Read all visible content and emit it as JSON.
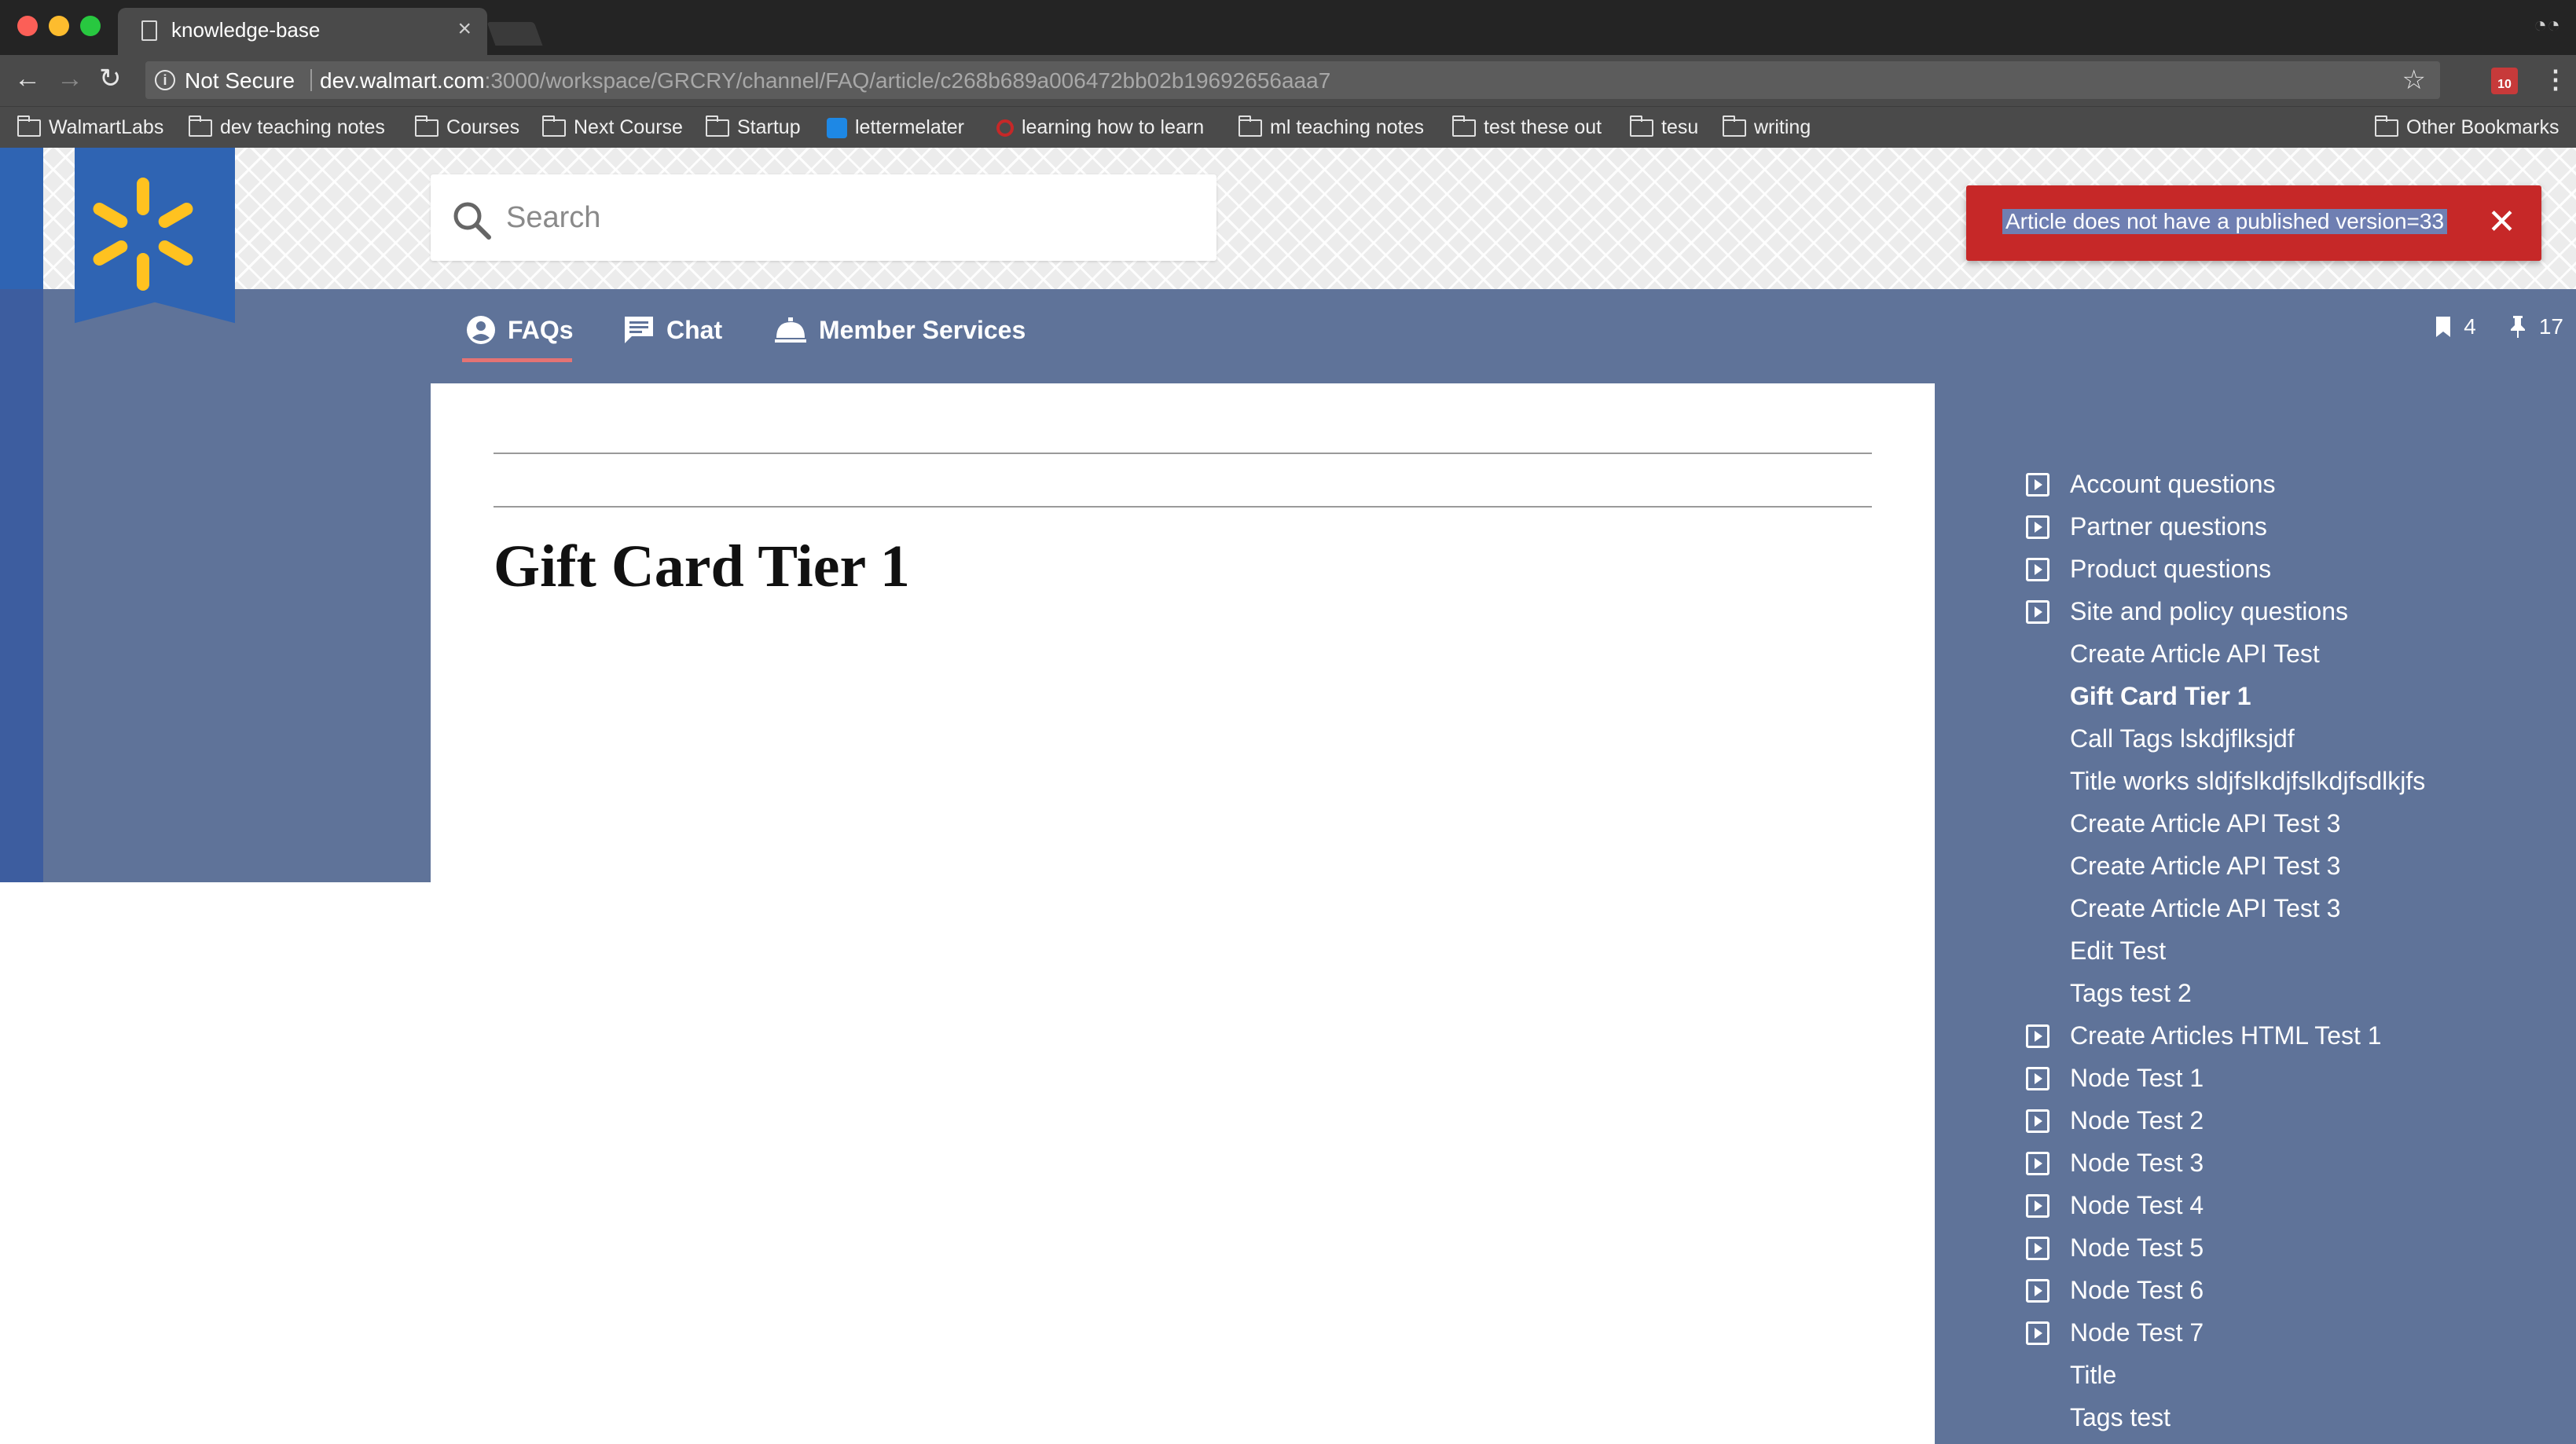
{
  "browser": {
    "tab_title": "knowledge-base",
    "tab_close": "×",
    "security_label": "Not Secure",
    "url_host": "dev.walmart.com",
    "url_path": ":3000/workspace/GRCRY/channel/FAQ/article/c268b689a006472bb02b19692656aaa7",
    "extension_badge": "10",
    "bookmarks": [
      {
        "label": "WalmartLabs",
        "icon": "folder-icon"
      },
      {
        "label": "dev teaching notes",
        "icon": "folder-icon"
      },
      {
        "label": "Courses",
        "icon": "folder-icon"
      },
      {
        "label": "Next Course",
        "icon": "folder-icon"
      },
      {
        "label": "Startup",
        "icon": "folder-icon"
      },
      {
        "label": "lettermelater",
        "icon": "site-icon"
      },
      {
        "label": "learning how to learn",
        "icon": "site-icon"
      },
      {
        "label": "ml teaching notes",
        "icon": "folder-icon"
      },
      {
        "label": "test these out",
        "icon": "folder-icon"
      },
      {
        "label": "tesu",
        "icon": "folder-icon"
      },
      {
        "label": "writing",
        "icon": "folder-icon"
      }
    ],
    "other_bookmarks": "Other Bookmarks"
  },
  "header": {
    "search_placeholder": "Search",
    "alert_text": "Article does not have a published version=33",
    "alert_close": "✕"
  },
  "nav": {
    "tabs": [
      {
        "label": "FAQs",
        "icon": "account-circle-icon"
      },
      {
        "label": "Chat",
        "icon": "chat-icon"
      },
      {
        "label": "Member Services",
        "icon": "service-bell-icon"
      }
    ],
    "active_tab": "FAQs",
    "bookmark_count": "4",
    "pin_count": "17"
  },
  "article": {
    "title": "Gift Card Tier 1"
  },
  "toc": {
    "items": [
      {
        "label": "Account questions",
        "expandable": true,
        "active": false
      },
      {
        "label": "Partner questions",
        "expandable": true,
        "active": false
      },
      {
        "label": "Product questions",
        "expandable": true,
        "active": false
      },
      {
        "label": "Site and policy questions",
        "expandable": true,
        "active": false
      },
      {
        "label": "Create Article API Test",
        "expandable": false,
        "active": false
      },
      {
        "label": "Gift Card Tier 1",
        "expandable": false,
        "active": true
      },
      {
        "label": "Call Tags lskdjflksjdf",
        "expandable": false,
        "active": false
      },
      {
        "label": "Title works sldjfslkdjfslkdjfsdlkjfs",
        "expandable": false,
        "active": false
      },
      {
        "label": "Create Article API Test 3",
        "expandable": false,
        "active": false
      },
      {
        "label": "Create Article API Test 3",
        "expandable": false,
        "active": false
      },
      {
        "label": "Create Article API Test 3",
        "expandable": false,
        "active": false
      },
      {
        "label": "Edit Test",
        "expandable": false,
        "active": false
      },
      {
        "label": "Tags test 2",
        "expandable": false,
        "active": false
      },
      {
        "label": "Create Articles HTML Test 1",
        "expandable": true,
        "active": false
      },
      {
        "label": "Node Test 1",
        "expandable": true,
        "active": false
      },
      {
        "label": "Node Test 2",
        "expandable": true,
        "active": false
      },
      {
        "label": "Node Test 3",
        "expandable": true,
        "active": false
      },
      {
        "label": "Node Test 4",
        "expandable": true,
        "active": false
      },
      {
        "label": "Node Test 5",
        "expandable": true,
        "active": false
      },
      {
        "label": "Node Test 6",
        "expandable": true,
        "active": false
      },
      {
        "label": "Node Test 7",
        "expandable": true,
        "active": false
      },
      {
        "label": "Title",
        "expandable": false,
        "active": false
      },
      {
        "label": "Tags test",
        "expandable": false,
        "active": false
      }
    ]
  },
  "colors": {
    "brand_blue": "#2f64b3",
    "spark_yellow": "#ffc220",
    "panel_blue": "#5f7399",
    "alert_red": "#c62828",
    "tab_accent": "#e57373"
  }
}
